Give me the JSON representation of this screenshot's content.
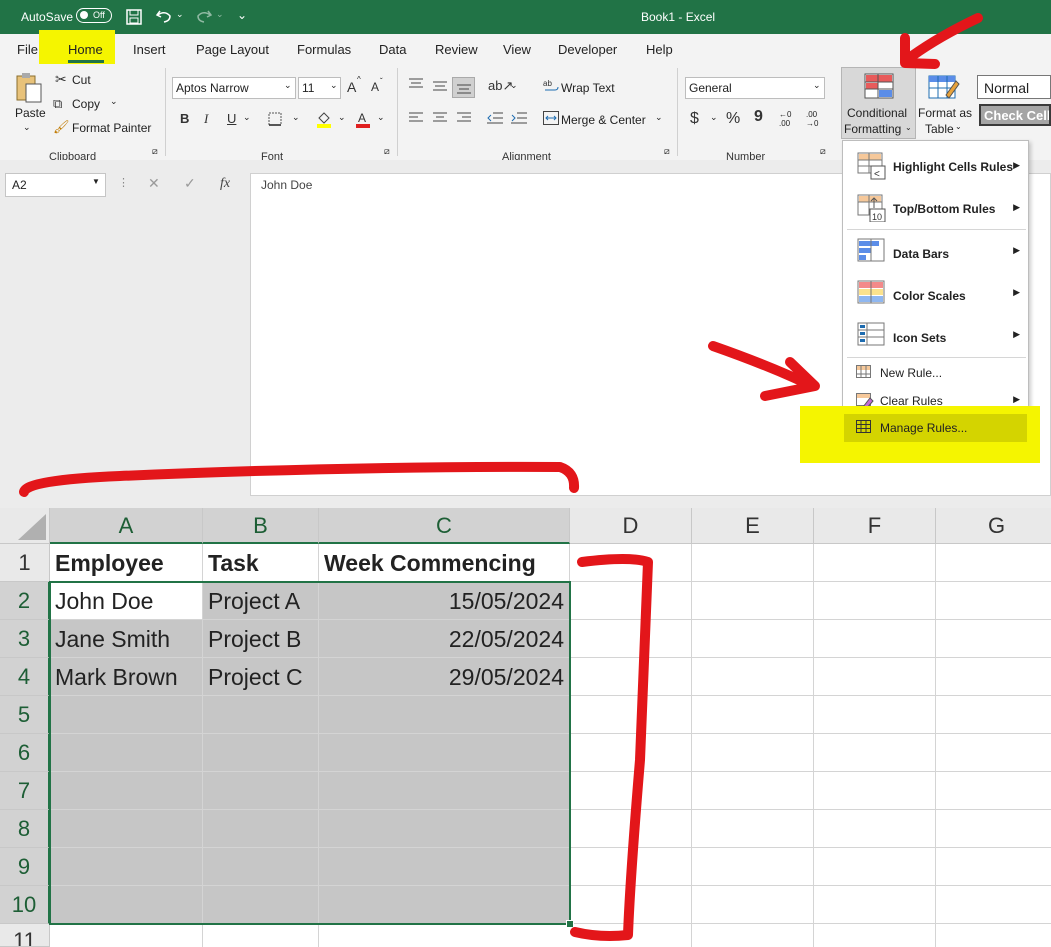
{
  "titlebar": {
    "autosave": "AutoSave",
    "toggle_state": "Off",
    "title": "Book1 - Excel"
  },
  "tabs": [
    "File",
    "Home",
    "Insert",
    "Page Layout",
    "Formulas",
    "Data",
    "Review",
    "View",
    "Developer",
    "Help"
  ],
  "ribbon": {
    "clipboard": {
      "paste": "Paste",
      "cut": "Cut",
      "copy": "Copy",
      "format_painter": "Format Painter",
      "group": "Clipboard"
    },
    "font": {
      "name": "Aptos Narrow",
      "size": "11",
      "grow": "A",
      "shrink": "A",
      "bold": "B",
      "italic": "I",
      "underline": "U",
      "group": "Font"
    },
    "alignment": {
      "wrap": "Wrap Text",
      "merge": "Merge & Center",
      "group": "Alignment"
    },
    "number": {
      "format": "General",
      "currency": "$",
      "percent": "%",
      "comma": "9",
      "inc": ".00",
      "dec": ".00",
      "group": "Number"
    },
    "styles": {
      "conditional1": "Conditional",
      "conditional2": "Formatting",
      "format_table1": "Format as",
      "format_table2": "Table",
      "normal": "Normal",
      "check_cell": "Check Cell"
    }
  },
  "formula_bar": {
    "namebox": "A2",
    "fx": "fx",
    "content": "John Doe"
  },
  "columns": [
    "A",
    "B",
    "C",
    "D",
    "E",
    "F",
    "G"
  ],
  "rows": [
    "1",
    "2",
    "3",
    "4",
    "5",
    "6",
    "7",
    "8",
    "9",
    "10",
    "11"
  ],
  "cells": {
    "A1": "Employee",
    "B1": "Task",
    "C1": "Week Commencing",
    "A2": "John Doe",
    "B2": "Project A",
    "C2": "15/05/2024",
    "A3": "Jane Smith",
    "B3": "Project B",
    "C3": "22/05/2024",
    "A4": "Mark Brown",
    "B4": "Project C",
    "C4": "29/05/2024"
  },
  "cf_menu": {
    "highlight": "Highlight Cells Rules",
    "topbottom": "Top/Bottom Rules",
    "databars": "Data Bars",
    "colorscales": "Color Scales",
    "iconsets": "Icon Sets",
    "newrule": "New Rule...",
    "clearrules": "Clear Rules",
    "managerules": "Manage Rules...",
    "topbottom_icon_num": "10"
  },
  "colors": {
    "excel_green": "#217346",
    "highlight": "#f5f500",
    "annotation_red": "#e3161a",
    "selection_shade": "#c6c6c6"
  }
}
